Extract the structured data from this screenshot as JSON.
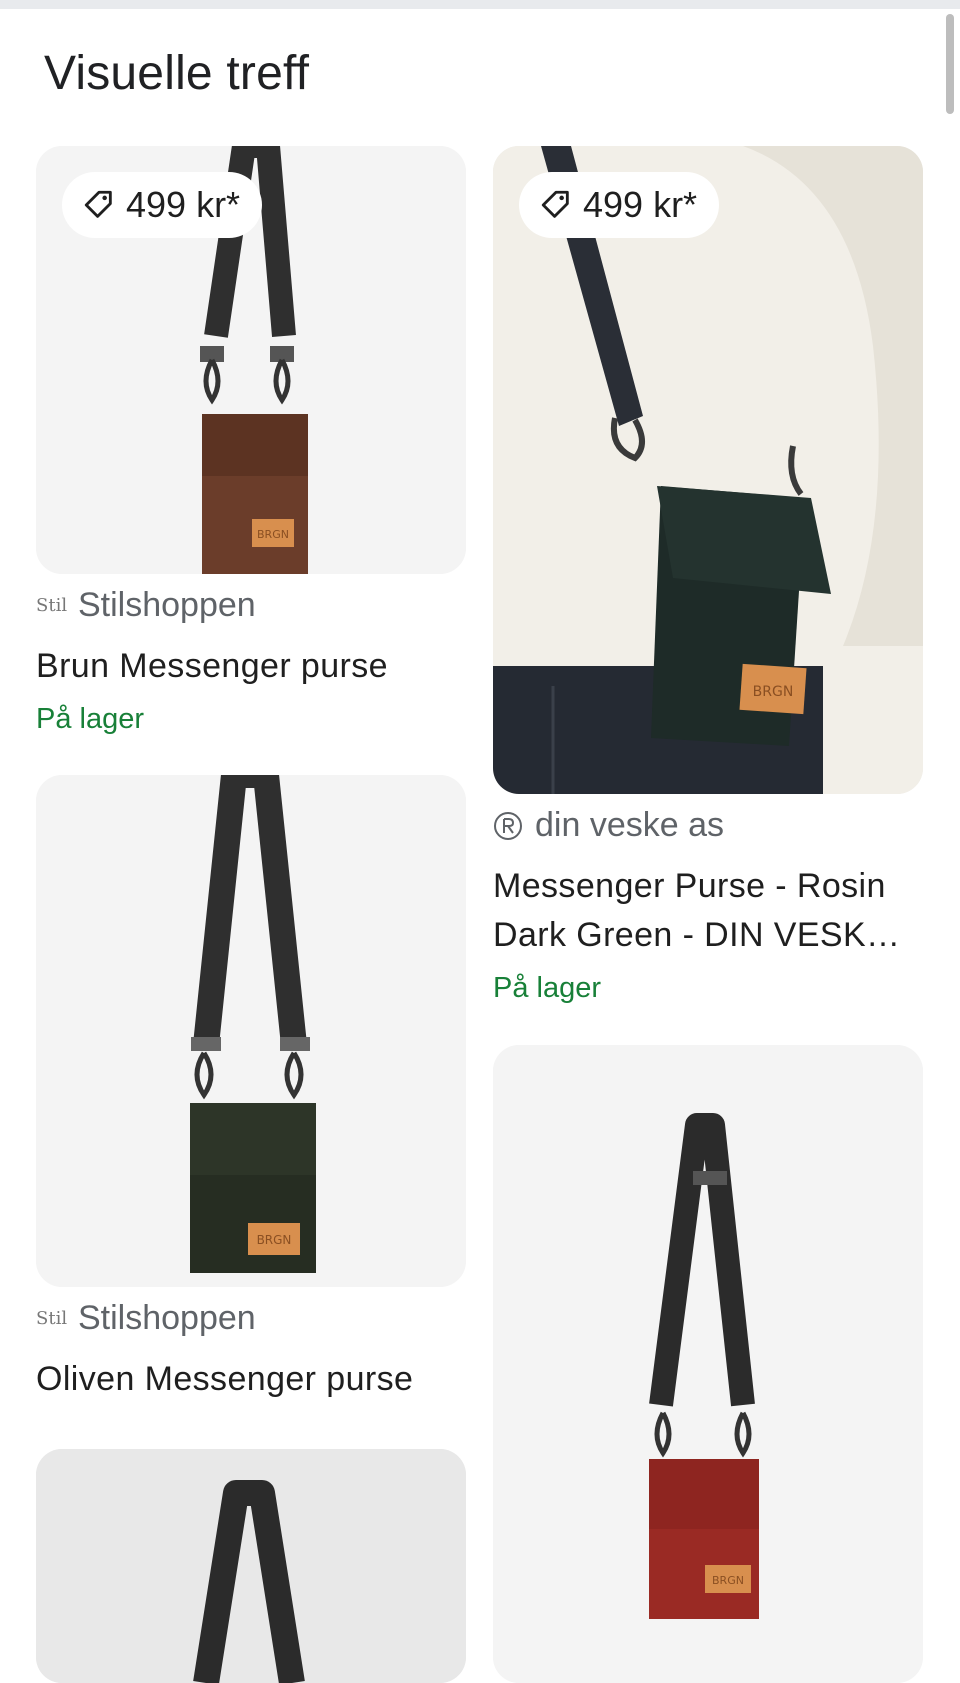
{
  "section_title": "Visuelle treff",
  "results": [
    {
      "price": "499 kr*",
      "source": "Stilshoppen",
      "source_favicon_text": "Stil",
      "title": "Brun Messenger purse",
      "stock": "På lager",
      "bag_color": "#6b3d2a",
      "patch_text": "BRGN"
    },
    {
      "price": "499 kr*",
      "source": "din veske as",
      "title_line1": "Messenger Purse - Rosin",
      "title_line2": "Dark Green - DIN VESK…",
      "stock": "På lager",
      "bag_color": "#1e2b28",
      "patch_text": "BRGN"
    },
    {
      "source": "Stilshoppen",
      "source_favicon_text": "Stil",
      "title": "Oliven Messenger purse",
      "bag_color": "#262d22",
      "patch_text": "BRGN"
    },
    {
      "bag_color": "#9a2a24",
      "patch_text": "BRGN"
    },
    {
      "bag_color": "#2b2b2b"
    }
  ],
  "colors": {
    "accent_green": "#188038",
    "muted_text": "#5f6368",
    "card_bg": "#f4f4f4"
  }
}
